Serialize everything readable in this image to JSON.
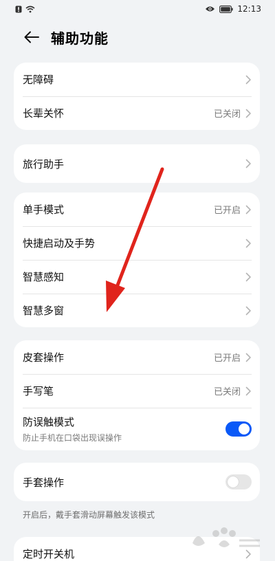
{
  "status_bar": {
    "time": "12:13"
  },
  "header": {
    "title": "辅助功能"
  },
  "groups": [
    {
      "rows": [
        {
          "label": "无障碍",
          "value": ""
        },
        {
          "label": "长辈关怀",
          "value": "已关闭"
        }
      ]
    },
    {
      "rows": [
        {
          "label": "旅行助手",
          "value": ""
        }
      ]
    },
    {
      "rows": [
        {
          "label": "单手模式",
          "value": "已开启"
        },
        {
          "label": "快捷启动及手势",
          "value": ""
        },
        {
          "label": "智慧感知",
          "value": ""
        },
        {
          "label": "智慧多窗",
          "value": ""
        }
      ]
    },
    {
      "rows": [
        {
          "label": "皮套操作",
          "value": "已开启"
        },
        {
          "label": "手写笔",
          "value": "已关闭"
        }
      ],
      "toggle_row": {
        "label": "防误触模式",
        "subtitle": "防止手机在口袋出现误操作",
        "on": true
      }
    },
    {
      "toggle_row": {
        "label": "手套操作",
        "on": false
      }
    },
    {
      "rows": [
        {
          "label": "定时开关机",
          "value": ""
        }
      ]
    }
  ],
  "notes": {
    "glove": "开启后，戴手套滑动屏幕触发该模式"
  },
  "colors": {
    "accent": "#0a59f7",
    "arrow": "#e0241c"
  },
  "icons": [
    "wifi-icon",
    "eye-icon",
    "battery-icon",
    "back-arrow-icon",
    "chevron-right-icon",
    "baidu-watermark-icon"
  ]
}
